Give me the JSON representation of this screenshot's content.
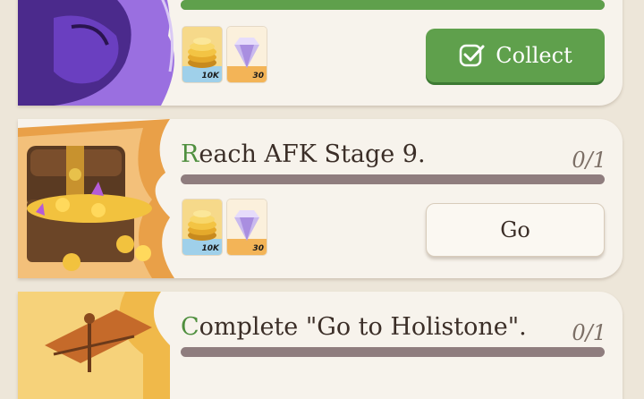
{
  "quests": [
    {
      "title_first": "",
      "title_rest": "",
      "progress": "",
      "progress_fraction": 1.0,
      "rewards": [
        {
          "icon": "gold-coins-icon",
          "qty": "10K"
        },
        {
          "icon": "diamond-icon",
          "qty": "30"
        }
      ],
      "button_label": "Collect",
      "button_state": "collect"
    },
    {
      "title_first": "R",
      "title_rest": "each AFK Stage 9.",
      "progress": "0/1",
      "progress_fraction": 0,
      "rewards": [
        {
          "icon": "gold-coins-icon",
          "qty": "10K"
        },
        {
          "icon": "diamond-icon",
          "qty": "30"
        }
      ],
      "button_label": "Go",
      "button_state": "go"
    },
    {
      "title_first": "C",
      "title_rest": "omplete \"Go to Holistone\".",
      "progress": "0/1",
      "progress_fraction": 0
    }
  ],
  "colors": {
    "accent_green": "#5fa04c",
    "bar_track": "#8f7d7e",
    "card_bg": "#f7f3ec",
    "page_bg": "#ede6d9"
  }
}
